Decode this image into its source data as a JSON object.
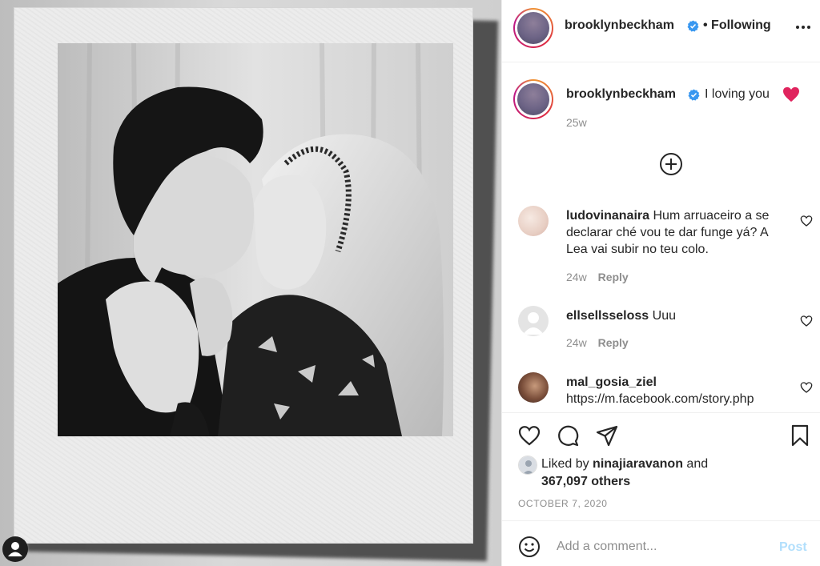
{
  "post": {
    "author": "brooklynbeckham",
    "follow_status": "• Following",
    "caption": "I loving you",
    "caption_time": "25w"
  },
  "comments": [
    {
      "username": "ludovinanaira",
      "text": "Hum arruaceiro a se declarar ché vou te dar funge yá? A Lea vai subir no teu colo.",
      "time": "24w",
      "reply": "Reply"
    },
    {
      "username": "ellsellsseloss",
      "text": "Uuu",
      "time": "24w",
      "reply": "Reply"
    },
    {
      "username": "mal_gosia_ziel",
      "text": "https://m.facebook.com/story.php"
    }
  ],
  "likes": {
    "prefix": "Liked by",
    "user": "ninajiaravanon",
    "conjunction": "and",
    "others": "367,097 others"
  },
  "date": "OCTOBER 7, 2020",
  "comment_box": {
    "placeholder": "Add a comment...",
    "post_label": "Post"
  },
  "icons": {
    "verified": "verified-badge-icon",
    "more": "more-options-icon",
    "load_more": "plus-circle-icon",
    "like": "heart-outline-icon",
    "comment": "comment-bubble-icon",
    "share": "paper-plane-icon",
    "save": "bookmark-icon",
    "emoji": "smiley-icon"
  },
  "colors": {
    "verified_blue": "#3897f0",
    "post_button_disabled": "#b2dffc",
    "muted_text": "#8e8e8e",
    "heart_red": "#ed4956"
  }
}
